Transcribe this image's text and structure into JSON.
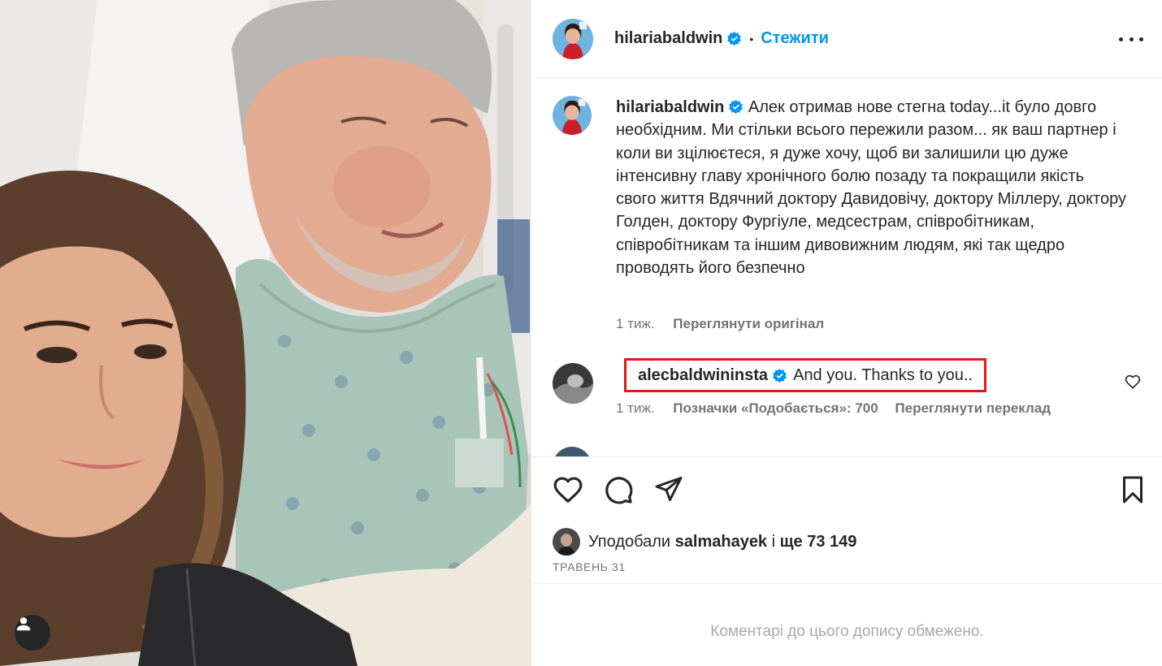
{
  "post": {
    "username": "hilariabaldwin",
    "separator": "•",
    "follow_label": "Стежити",
    "caption": "Алек отримав нове стегна today...it було довго необхідним. Ми стільки всього пережили разом... як ваш партнер і коли ви зцілюєтеся, я дуже хочу, щоб ви залишили цю дуже інтенсивну главу хронічного болю позаду та покращили якість свого життя Вдячний доктору Давидовічу, доктору Міллеру, доктору Голден, доктору Фургіуле, медсестрам, співробітникам, співробітникам та іншим дивовижним людям, які так щедро проводять його безпечно",
    "caption_time": "1 тиж.",
    "see_original": "Переглянути оригінал"
  },
  "comment": {
    "username": "alecbaldwininsta",
    "text": "And you. Thanks to you..",
    "time": "1 тиж.",
    "likes": "Позначки «Подобається»: 700",
    "translate": "Переглянути переклад"
  },
  "likes": {
    "prefix": "Уподобали",
    "user": "salmahayek",
    "middle": "і",
    "rest": "ще 73 149"
  },
  "date": "ТРАВЕНЬ 31",
  "restricted": "Коментарі до цього допису обмежено.",
  "colors": {
    "accent": "#0095f6",
    "highlight": "#e4161b",
    "muted": "#737373"
  },
  "icons": [
    "verified-icon",
    "more-icon",
    "heart-icon",
    "comment-icon",
    "share-icon",
    "bookmark-icon",
    "user-tag-icon"
  ]
}
